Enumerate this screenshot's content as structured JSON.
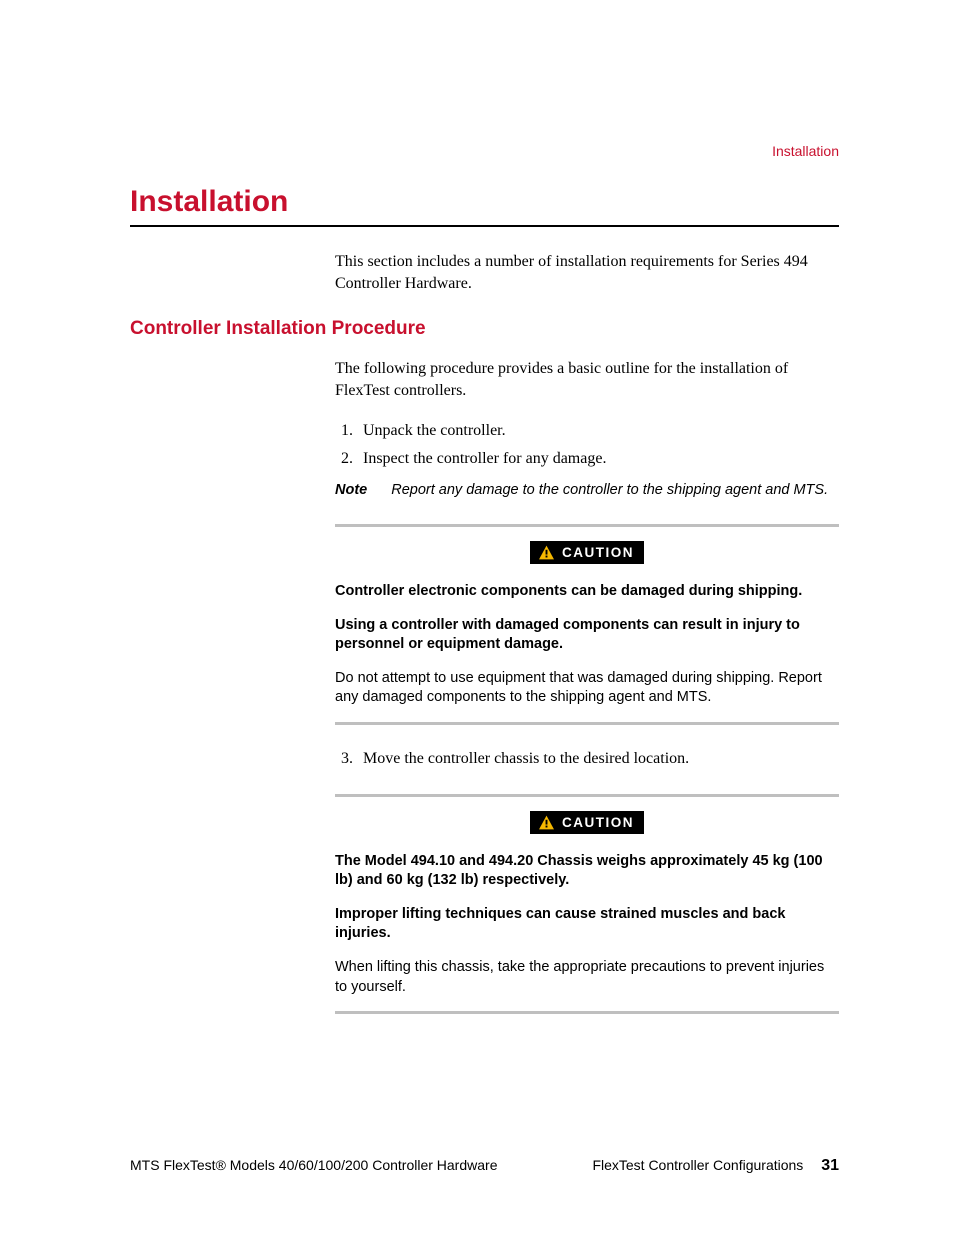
{
  "header": {
    "section_label": "Installation"
  },
  "title": "Installation",
  "intro": "This section includes a number of installation requirements for Series 494 Controller Hardware.",
  "subheading": "Controller Installation Procedure",
  "procedure_intro": "The following procedure provides a basic outline for the installation of FlexTest controllers.",
  "steps_a": [
    "Unpack the controller.",
    "Inspect the controller for any damage."
  ],
  "note": {
    "label": "Note",
    "text": "Report any damage to the controller to the shipping agent and MTS."
  },
  "caution_label": "CAUTION",
  "caution1": {
    "bold1": "Controller electronic components can be damaged during shipping.",
    "bold2": "Using a controller with damaged components can result in injury to personnel or equipment damage.",
    "body": "Do not attempt to use equipment that was damaged during shipping. Report any damaged components to the shipping agent and MTS."
  },
  "steps_b": [
    "Move the controller chassis to the desired location."
  ],
  "caution2": {
    "bold1": "The Model 494.10 and 494.20 Chassis weighs approximately 45 kg (100 lb) and 60 kg (132 lb) respectively.",
    "bold2": "Improper lifting techniques can cause strained muscles and back injuries.",
    "body": "When lifting this chassis, take the appropriate precautions to prevent injuries to yourself."
  },
  "footer": {
    "left": "MTS FlexTest® Models 40/60/100/200 Controller Hardware",
    "right": "FlexTest Controller Configurations",
    "page": "31"
  }
}
